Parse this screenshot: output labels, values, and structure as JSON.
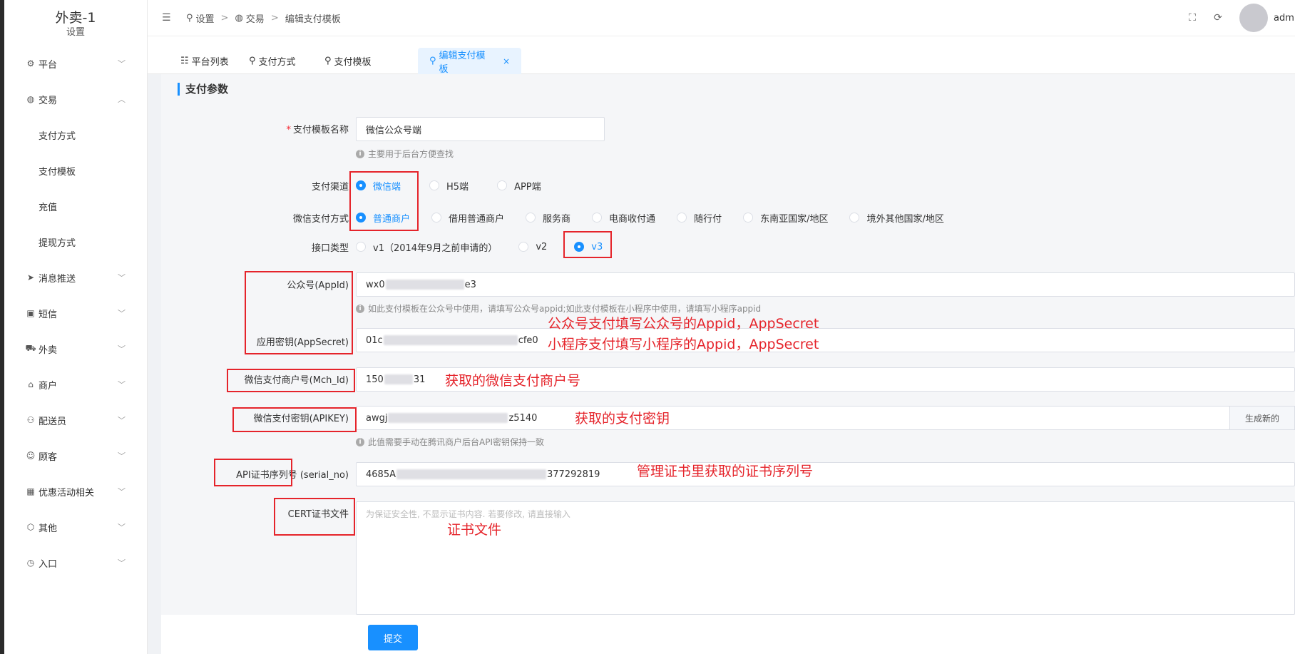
{
  "sidebar": {
    "brand": "外卖-1",
    "subtitle": "设置",
    "items": [
      {
        "label": "平台",
        "icon": "gear-icon",
        "expanded": false
      },
      {
        "label": "交易",
        "icon": "wallet-icon",
        "expanded": true
      },
      {
        "label": "消息推送",
        "icon": "send-icon",
        "expanded": false
      },
      {
        "label": "短信",
        "icon": "chat-icon",
        "expanded": false
      },
      {
        "label": "外卖",
        "icon": "truck-icon",
        "expanded": false
      },
      {
        "label": "商户",
        "icon": "shop-icon",
        "expanded": false
      },
      {
        "label": "配送员",
        "icon": "courier-icon",
        "expanded": false
      },
      {
        "label": "顾客",
        "icon": "user-circle-icon",
        "expanded": false
      },
      {
        "label": "优惠活动相关",
        "icon": "gift-icon",
        "expanded": false
      },
      {
        "label": "其他",
        "icon": "hexagon-icon",
        "expanded": false
      },
      {
        "label": "入口",
        "icon": "compass-icon",
        "expanded": false
      }
    ],
    "trade_sub": [
      "支付方式",
      "支付模板",
      "充值",
      "提现方式"
    ]
  },
  "header": {
    "breadcrumb": [
      "设置",
      "交易",
      "编辑支付模板"
    ],
    "user": "admin"
  },
  "tabs": [
    {
      "label": "平台列表",
      "active": false
    },
    {
      "label": "支付方式",
      "active": false
    },
    {
      "label": "支付模板",
      "active": false
    },
    {
      "label": "编辑支付模板",
      "active": true
    }
  ],
  "form": {
    "section_title": "支付参数",
    "template_name_label": "支付模板名称",
    "template_name_value": "微信公众号端",
    "template_name_hint": "主要用于后台方便查找",
    "channel_label": "支付渠道",
    "channel_options": [
      "微信端",
      "H5端",
      "APP端"
    ],
    "channel_selected": "微信端",
    "wx_method_label": "微信支付方式",
    "wx_method_options": [
      "普通商户",
      "借用普通商户",
      "服务商",
      "电商收付通",
      "随行付",
      "东南亚国家/地区",
      "境外其他国家/地区"
    ],
    "wx_method_selected": "普通商户",
    "api_type_label": "接口类型",
    "api_type_options": [
      "v1（2014年9月之前申请的）",
      "v2",
      "v3"
    ],
    "api_type_selected": "v3",
    "appid_label": "公众号(AppId)",
    "appid_prefix": "wx0",
    "appid_suffix": "e3",
    "appid_hint": "如此支付模板在公众号中使用，请填写公众号appid;如此支付模板在小程序中使用，请填写小程序appid",
    "appsecret_label": "应用密钥(AppSecret)",
    "appsecret_prefix": "01c",
    "appsecret_suffix": "cfe0",
    "mchid_label": "微信支付商户号(Mch_Id)",
    "mchid_prefix": "150",
    "mchid_suffix": "31",
    "apikey_label": "微信支付密钥(APIKEY)",
    "apikey_prefix": "awgj",
    "apikey_suffix": "z5140",
    "apikey_button": "生成新的",
    "apikey_hint": "此值需要手动在腾讯商户后台API密钥保持一致",
    "serial_label": "API证书序列号",
    "serial_label_suffix": "(serial_no)",
    "serial_prefix": "4685A",
    "serial_suffix": "377292819",
    "cert_label": "CERT证书文件",
    "cert_placeholder": "为保证安全性, 不显示证书内容. 若要修改, 请直接输入",
    "submit": "提交"
  },
  "annotations": {
    "appid_note_1": "公众号支付填写公众号的Appid，AppSecret",
    "appid_note_2": "小程序支付填写小程序的Appid，AppSecret",
    "mchid_note": "获取的微信支付商户号",
    "apikey_note": "获取的支付密钥",
    "serial_note": "管理证书里获取的证书序列号",
    "cert_note": "证书文件",
    "color": "#e5242b"
  },
  "colors": {
    "primary": "#1890ff",
    "annotation": "#e5242b"
  }
}
